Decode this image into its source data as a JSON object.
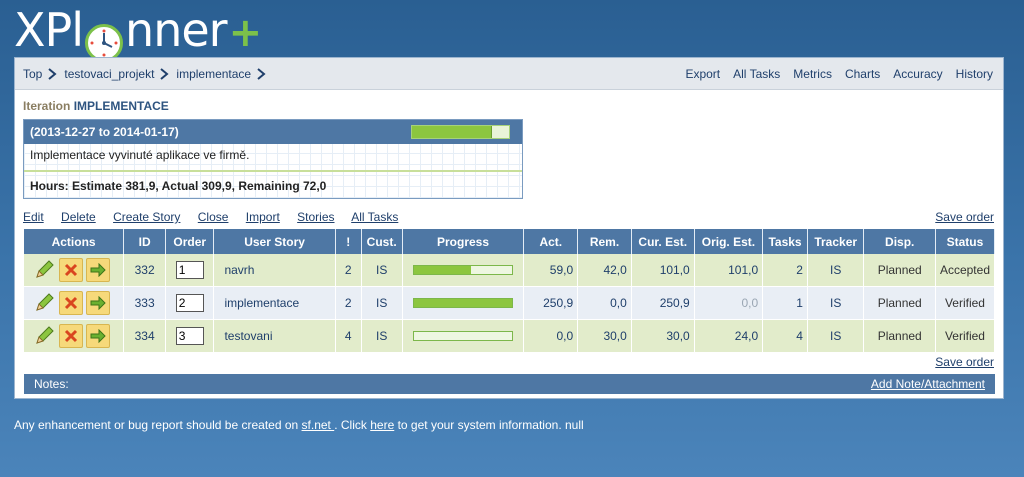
{
  "logo": {
    "part1": "XPl",
    "part2": "nner",
    "plus": "+"
  },
  "breadcrumb": [
    "Top",
    "testovaci_projekt",
    "implementace"
  ],
  "topnav": [
    "Export",
    "All Tasks",
    "Metrics",
    "Charts",
    "Accuracy",
    "History"
  ],
  "iteration": {
    "label": "Iteration",
    "name": "IMPLEMENTACE",
    "dates": "(2013-12-27 to 2014-01-17)",
    "description": "Implementace vyvinuté aplikace ve firmě.",
    "hours": "Hours: Estimate 381,9, Actual 309,9, Remaining 72,0",
    "progress": 0.81
  },
  "actions": [
    "Edit",
    "Delete",
    "Create Story",
    "Close",
    "Import",
    "Stories",
    "All Tasks"
  ],
  "save_order": "Save order",
  "table": {
    "headers": [
      "Actions",
      "ID",
      "Order",
      "User Story",
      "!",
      "Cust.",
      "Progress",
      "Act.",
      "Rem.",
      "Cur. Est.",
      "Orig. Est.",
      "Tasks",
      "Tracker",
      "Disp.",
      "Status"
    ],
    "rows": [
      {
        "id": "332",
        "order": "1",
        "story": "navrh",
        "priority": "2",
        "customer": "IS",
        "progress": 0.58,
        "actual": "59,0",
        "remaining": "42,0",
        "cur_est": "101,0",
        "orig_est": "101,0",
        "tasks": "2",
        "tracker": "IS",
        "disp": "Planned",
        "status": "Accepted"
      },
      {
        "id": "333",
        "order": "2",
        "story": "implementace",
        "priority": "2",
        "customer": "IS",
        "progress": 1.0,
        "actual": "250,9",
        "remaining": "0,0",
        "cur_est": "250,9",
        "orig_est": "0,0",
        "tasks": "1",
        "tracker": "IS",
        "disp": "Planned",
        "status": "Verified"
      },
      {
        "id": "334",
        "order": "3",
        "story": "testovani",
        "priority": "4",
        "customer": "IS",
        "progress": 0.0,
        "actual": "0,0",
        "remaining": "30,0",
        "cur_est": "30,0",
        "orig_est": "24,0",
        "tasks": "4",
        "tracker": "IS",
        "disp": "Planned",
        "status": "Verified"
      }
    ]
  },
  "notes": {
    "label": "Notes:",
    "add_link": "Add Note/Attachment"
  },
  "footer": {
    "text1": "Any enhancement or bug report should be created on ",
    "link1": "sf.net ",
    "text2": ". Click ",
    "link2": "here",
    "text3": " to get your system information. null"
  },
  "colors": {
    "header_blue": "#4e77a4",
    "progress_green": "#8cc63f",
    "row_green": "#e2eccb",
    "row_blue": "#e9eef5"
  }
}
